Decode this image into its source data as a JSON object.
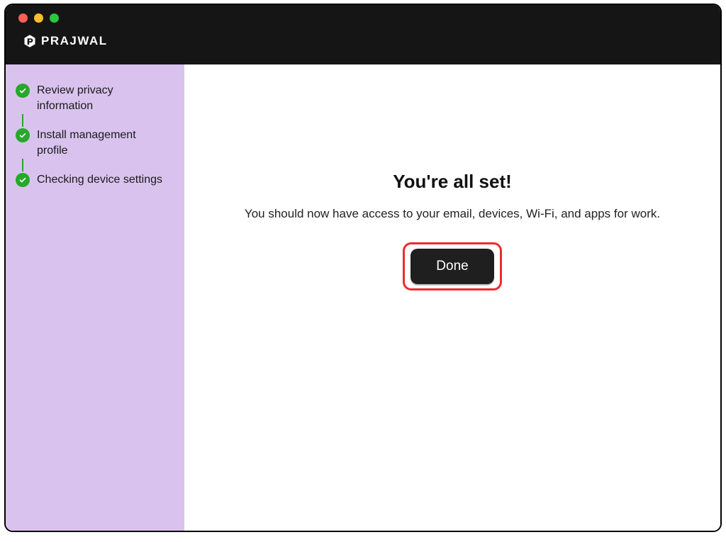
{
  "brand": {
    "name": "PRAJWAL"
  },
  "sidebar": {
    "steps": [
      {
        "label": "Review privacy information"
      },
      {
        "label": "Install management profile"
      },
      {
        "label": "Checking device settings"
      }
    ]
  },
  "main": {
    "headline": "You're all set!",
    "subtext": "You should now have access to your email, devices, Wi-Fi, and apps for work.",
    "done_label": "Done"
  }
}
